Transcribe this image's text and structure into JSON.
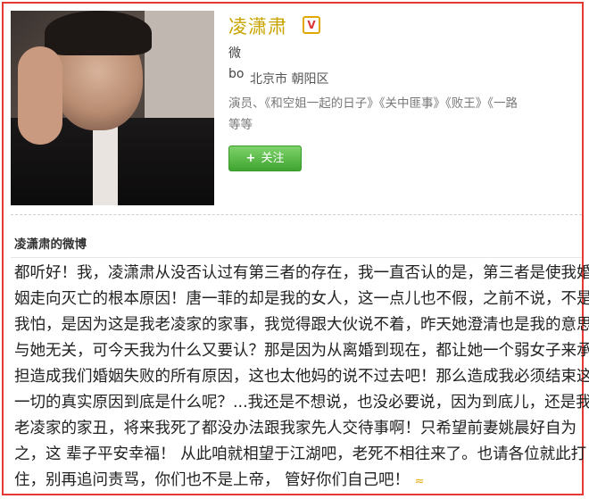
{
  "profile": {
    "name": "凌潇肃",
    "verified_mark": "V",
    "wei": "微",
    "location_icon": "bo",
    "location": "北京市 朝阳区",
    "description_line1": "演员、《和空姐一起的日子》《关中匪事》《败王》《一路",
    "description_line2": "等等",
    "follow_label": "关注",
    "follow_icon": "+"
  },
  "section_title": "凌潇肃的微博",
  "post": {
    "lines": [
      "都听好！我，凌潇肃从没否认过有第三者的存在，我一直否认的是，第三者是使我婚",
      "姻走向灭亡的根本原因！唐一菲的却是我的女人，这一点儿也不假，之前不说，不是",
      "我怕，是因为这是我老凌家的家事，我觉得跟大伙说不着，昨天她澄清也是我的意思",
      "与她无关，可今天我为什么又要认？那是因为从离婚到现在，都让她一个弱女子来承",
      "担造成我们婚姻失败的所有原因，这也太他妈的说不过去吧！那么造成我必须结束这",
      "一切的真实原因到底是什么呢？...我还是不想说，也没必要说，因为到底儿，还是我",
      "老凌家的家丑，将来我死了都没办法跟我家先人交待事啊！只希望前妻姚晨好自为",
      "之，这 辈子平安幸福！ 从此咱就相望于江湖吧，老死不相往来了。也请各位就此打",
      "住，别再追问责骂，你们也不是上帝， 管好你们自己吧！"
    ],
    "more_icon": "≈"
  },
  "colors": {
    "frame": "#e53935",
    "name": "#c9a400",
    "follow": "#3fa430"
  }
}
